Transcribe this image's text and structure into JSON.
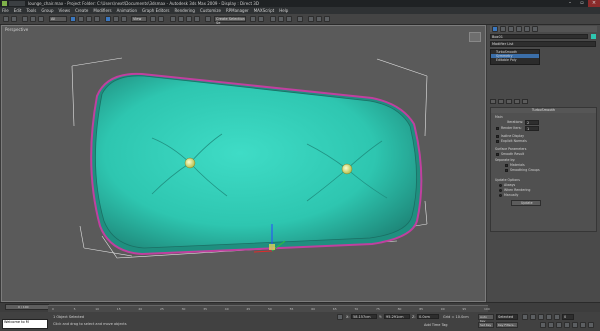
{
  "window": {
    "title": "lounge_chair.max   - Project Folder: C:\\Users\\next\\Documents\\3dsmax      - Autodesk 3ds Max  2009      - Display : Direct 3D"
  },
  "menu": [
    "File",
    "Edit",
    "Tools",
    "Group",
    "Views",
    "Create",
    "Modifiers",
    "Animation",
    "Graph Editors",
    "Rendering",
    "Customize",
    "RPManager",
    "MAXScript",
    "Help"
  ],
  "toolbar": {
    "selection_filter": "All",
    "view_dropdown": "View",
    "named_selection": "Create Selection Se"
  },
  "viewport": {
    "label": "Perspective",
    "colors": {
      "cushion": "#2ec6b0",
      "cushion_shadow": "#1c7f72",
      "outline": "#c0409f",
      "button": "#e8f080",
      "background": "#5a5a5a"
    }
  },
  "command_panel": {
    "object_name": "Box01",
    "modifier_list": "Modifier List",
    "stack": [
      {
        "label": "TurboSmooth",
        "selected": false
      },
      {
        "label": "Symmetry",
        "selected": true
      },
      {
        "label": "Editable Poly",
        "selected": false
      }
    ],
    "turbosmooth": {
      "title": "TurboSmooth",
      "main": "Main",
      "iterations_label": "Iterations:",
      "iterations": "2",
      "render_iters_label": "Render Iters:",
      "render_iters": "1",
      "isoline_display": "Isoline Display",
      "explicit_normals": "Explicit Normals",
      "surface_params": "Surface Parameters",
      "smooth_result": "Smooth Result",
      "separate": "Separate by:",
      "materials": "Materials",
      "smoothing_groups": "Smoothing Groups",
      "update_options": "Update Options",
      "always": "Always",
      "when_rendering": "When Rendering",
      "manually": "Manually",
      "update": "Update"
    }
  },
  "timeline": {
    "frame": "0 / 100",
    "ticks": [
      "0",
      "5",
      "10",
      "15",
      "20",
      "25",
      "30",
      "35",
      "40",
      "45",
      "50",
      "55",
      "60",
      "65",
      "70",
      "75",
      "80",
      "85",
      "90",
      "95",
      "100"
    ]
  },
  "status": {
    "script_prompt": "Welcome to M",
    "selected": "1 Object Selected",
    "hint": "Click and drag to select and move objects",
    "x_label": "X:",
    "x_value": "58.157cm",
    "y_label": "Y:",
    "y_value": "95.291cm",
    "z_label": "Z:",
    "z_value": "0.0cm",
    "grid": "Grid = 10.0cm",
    "add_time_tag": "Add Time Tag",
    "auto_key": "Auto Key",
    "set_key": "Set Key",
    "key_filters": "Key Filters...",
    "key_mode": "Selected",
    "frame_field": "0"
  }
}
